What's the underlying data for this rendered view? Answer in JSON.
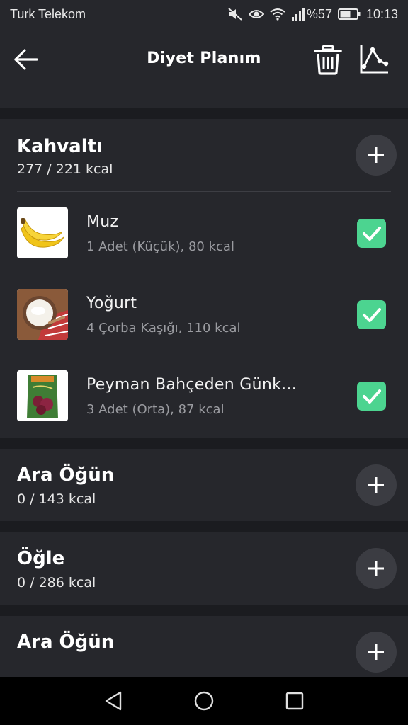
{
  "status_bar": {
    "carrier": "Turk Telekom",
    "battery": "%57",
    "time": "10:13"
  },
  "app_bar": {
    "title": "Diyet Planım"
  },
  "sections": [
    {
      "title": "Kahvaltı",
      "kcal": "277 / 221 kcal",
      "items": [
        {
          "name": "Muz",
          "detail": "1 Adet (Küçük), 80 kcal",
          "image": "banana",
          "checked": true
        },
        {
          "name": "Yoğurt",
          "detail": "4 Çorba Kaşığı, 110 kcal",
          "image": "yogurt",
          "checked": true
        },
        {
          "name": "Peyman Bahçeden Günk...",
          "detail": "3 Adet (Orta), 87 kcal",
          "image": "snack-package",
          "checked": true
        }
      ]
    },
    {
      "title": "Ara Öğün",
      "kcal": "0 / 143 kcal",
      "items": []
    },
    {
      "title": "Öğle",
      "kcal": "0 / 286 kcal",
      "items": []
    },
    {
      "title": "Ara Öğün",
      "kcal": "",
      "items": []
    }
  ],
  "colors": {
    "background": "#1b1c20",
    "card": "#26272c",
    "check_green": "#4cd490",
    "add_button": "#3b3c42"
  },
  "icons": [
    "back-arrow-icon",
    "trash-icon",
    "chart-icon",
    "plus-icon",
    "checkmark-icon",
    "nav-back-icon",
    "nav-home-icon",
    "nav-recents-icon"
  ]
}
